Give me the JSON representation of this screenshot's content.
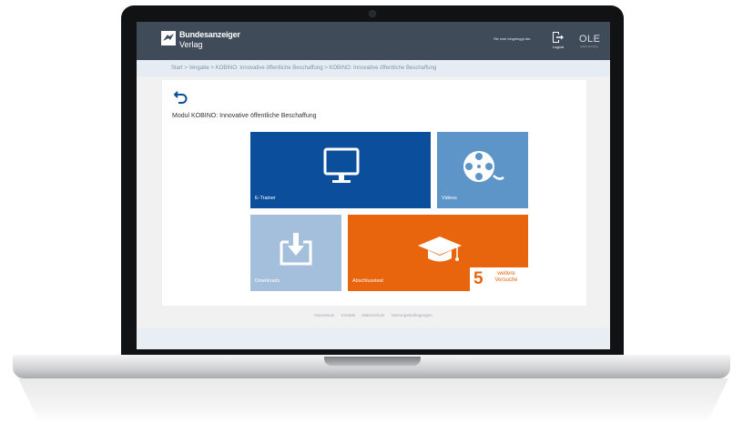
{
  "header": {
    "brand_line1": "Bundesanzeiger",
    "brand_line2": "Verlag",
    "user_label": "Sie sind eingeloggt als:",
    "logout_label": "Logout",
    "partner_logo": "OLE",
    "partner_sub": "online learning"
  },
  "breadcrumb": "Start > Vergabe > KOBINO: Innovative öffentliche Beschaffung > KOBINO: Innovative öffentliche Beschaffung",
  "module_title": "Modul KOBINO: Innovative öffentliche Beschaffung",
  "tiles": [
    {
      "label": "E-Trainer",
      "icon": "monitor-icon",
      "color": "#0b4f9c"
    },
    {
      "label": "Videos",
      "icon": "film-reel-icon",
      "color": "#5e95c9"
    },
    {
      "label": "Downloads",
      "icon": "download-icon",
      "color": "#a3bfdb"
    },
    {
      "label": "Abschlusstest",
      "icon": "graduation-cap-icon",
      "color": "#e8640d"
    }
  ],
  "attempts": {
    "count": "5",
    "text_line1": "weitere",
    "text_line2": "Versuche"
  },
  "footer": {
    "links": [
      "Impressum",
      "Kontakt",
      "Datenschutz",
      "Nutzungsbedingungen"
    ]
  }
}
